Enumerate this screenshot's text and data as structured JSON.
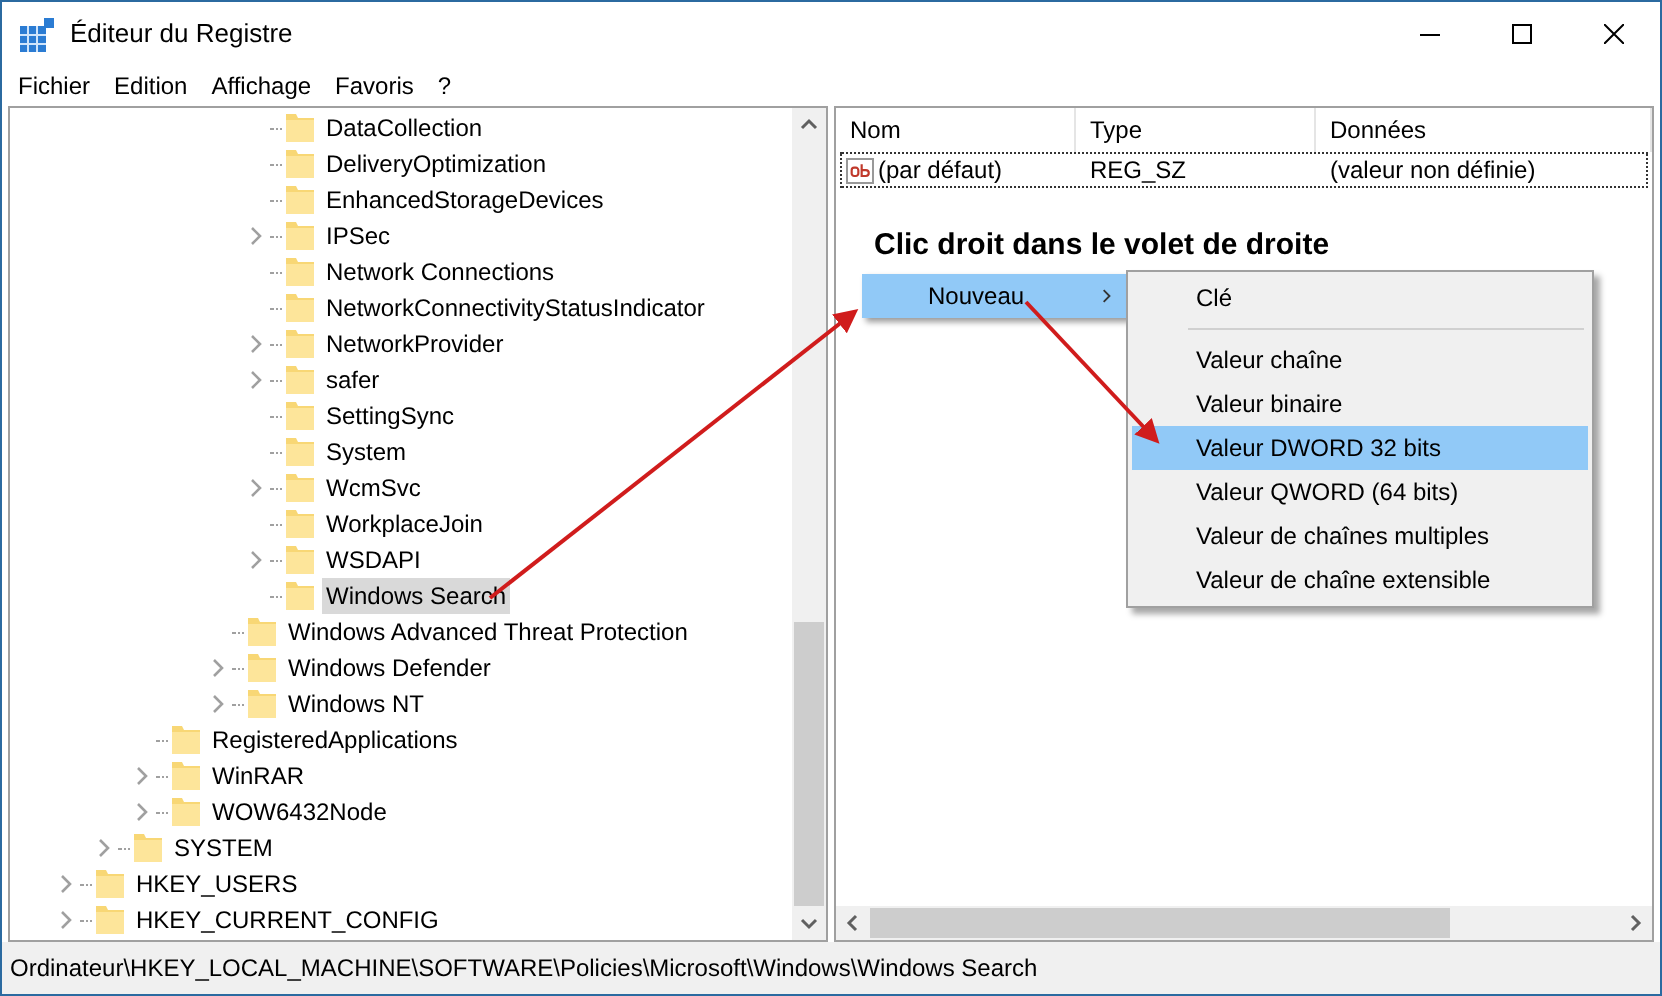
{
  "window": {
    "title": "Éditeur du Registre"
  },
  "menu": [
    "Fichier",
    "Edition",
    "Affichage",
    "Favoris",
    "?"
  ],
  "tree": [
    {
      "children": [
        {
          "children": [
            {
              "children": [
                {
                  "children": [
                    {
                      "children": [
                        {
                          "label": "DataCollection",
                          "expandable": false,
                          "selected": false
                        },
                        {
                          "label": "DeliveryOptimization",
                          "expandable": false,
                          "selected": false
                        },
                        {
                          "label": "EnhancedStorageDevices",
                          "expandable": false,
                          "selected": false
                        },
                        {
                          "label": "IPSec",
                          "expandable": true,
                          "selected": false
                        },
                        {
                          "label": "Network Connections",
                          "expandable": false,
                          "selected": false
                        },
                        {
                          "label": "NetworkConnectivityStatusIndicator",
                          "expandable": false,
                          "selected": false
                        },
                        {
                          "label": "NetworkProvider",
                          "expandable": true,
                          "selected": false
                        },
                        {
                          "label": "safer",
                          "expandable": true,
                          "selected": false
                        },
                        {
                          "label": "SettingSync",
                          "expandable": false,
                          "selected": false
                        },
                        {
                          "label": "System",
                          "expandable": false,
                          "selected": false
                        },
                        {
                          "label": "WcmSvc",
                          "expandable": true,
                          "selected": false
                        },
                        {
                          "label": "WorkplaceJoin",
                          "expandable": false,
                          "selected": false
                        },
                        {
                          "label": "WSDAPI",
                          "expandable": true,
                          "selected": false
                        },
                        {
                          "label": "Windows Search",
                          "expandable": false,
                          "selected": true
                        }
                      ]
                    },
                    {
                      "label": "Windows Advanced Threat Protection",
                      "expandable": false,
                      "selected": false
                    },
                    {
                      "label": "Windows Defender",
                      "expandable": true,
                      "selected": false
                    },
                    {
                      "label": "Windows NT",
                      "expandable": true,
                      "selected": false
                    }
                  ]
                }
              ]
            },
            {
              "label": "RegisteredApplications",
              "expandable": false,
              "selected": false
            },
            {
              "label": "WinRAR",
              "expandable": true,
              "selected": false
            },
            {
              "label": "WOW6432Node",
              "expandable": true,
              "selected": false
            }
          ]
        },
        {
          "label": "SYSTEM",
          "expandable": true,
          "selected": false
        }
      ]
    },
    {
      "label": "HKEY_USERS",
      "expandable": true,
      "selected": false
    },
    {
      "label": "HKEY_CURRENT_CONFIG",
      "expandable": true,
      "selected": false
    }
  ],
  "values_table": {
    "columns": [
      "Nom",
      "Type",
      "Données"
    ],
    "rows": [
      {
        "name": "(par défaut)",
        "type": "REG_SZ",
        "data": "(valeur non définie)"
      }
    ]
  },
  "annotation": "Clic droit dans le volet de droite",
  "context_menu": {
    "items": [
      {
        "label": "Nouveau",
        "submenu": true,
        "selected": true
      }
    ]
  },
  "submenu": {
    "items": [
      {
        "label": "Clé",
        "selected": false,
        "separator_after": true
      },
      {
        "label": "Valeur chaîne",
        "selected": false,
        "separator_after": false
      },
      {
        "label": "Valeur binaire",
        "selected": false,
        "separator_after": false
      },
      {
        "label": "Valeur DWORD 32 bits",
        "selected": true,
        "separator_after": false
      },
      {
        "label": "Valeur QWORD (64 bits)",
        "selected": false,
        "separator_after": false
      },
      {
        "label": "Valeur de chaînes multiples",
        "selected": false,
        "separator_after": false
      },
      {
        "label": "Valeur de chaîne extensible",
        "selected": false,
        "separator_after": false
      }
    ]
  },
  "status_bar": "Ordinateur\\HKEY_LOCAL_MACHINE\\SOFTWARE\\Policies\\Microsoft\\Windows\\Windows Search"
}
